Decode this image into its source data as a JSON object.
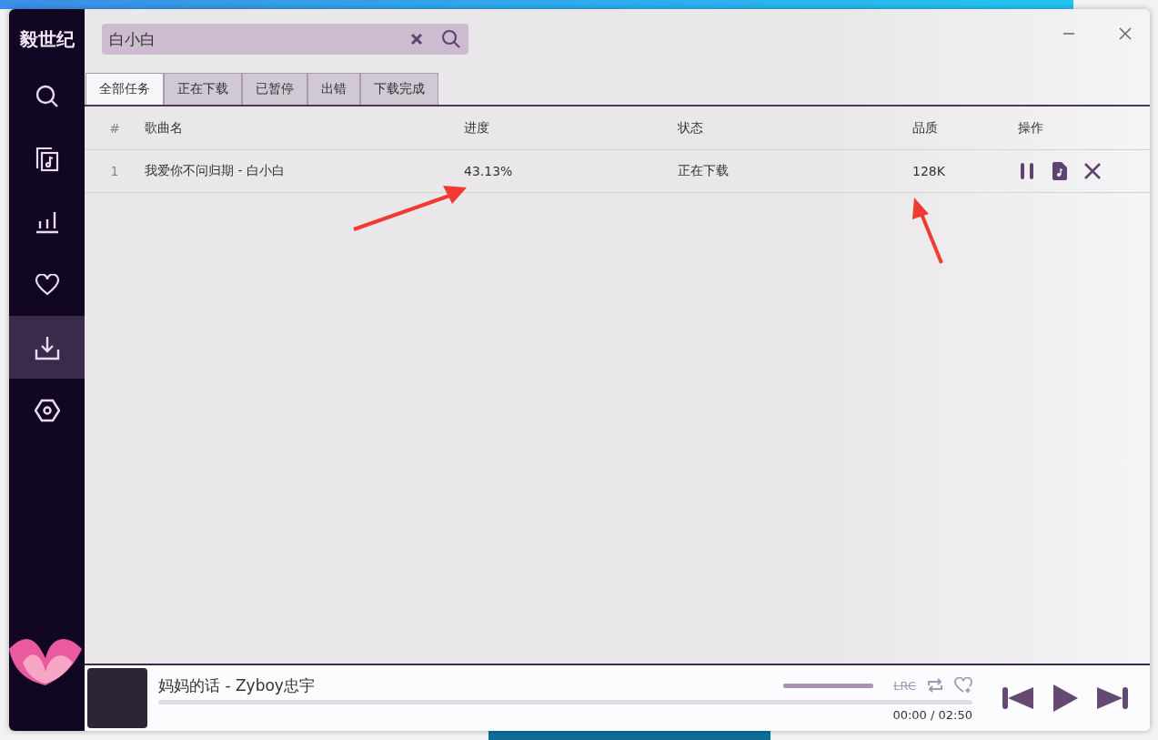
{
  "app": {
    "logo": "毅世纪"
  },
  "sidebar": {
    "items": [
      {
        "kind": "search",
        "selected": false
      },
      {
        "kind": "music",
        "selected": false
      },
      {
        "kind": "chart",
        "selected": false
      },
      {
        "kind": "heart",
        "selected": false
      },
      {
        "kind": "download",
        "selected": true
      },
      {
        "kind": "settings",
        "selected": false
      }
    ]
  },
  "search": {
    "value": "白小白"
  },
  "tabs": [
    {
      "label": "全部任务",
      "selected": true
    },
    {
      "label": "正在下载",
      "selected": false
    },
    {
      "label": "已暂停",
      "selected": false
    },
    {
      "label": "出错",
      "selected": false
    },
    {
      "label": "下载完成",
      "selected": false
    }
  ],
  "table": {
    "columns": [
      "#",
      "歌曲名",
      "进度",
      "状态",
      "品质",
      "操作"
    ],
    "rows": [
      {
        "index": "1",
        "name": "我爱你不问归期 - 白小白",
        "progress": "43.13%",
        "status": "正在下载",
        "quality": "128K"
      }
    ]
  },
  "player": {
    "title": "妈妈的话 - Zyboy忠宇",
    "volume": {
      "level": 1
    },
    "progress": {
      "level": 0
    },
    "lrc": "LRC",
    "time": "00:00 / 02:50"
  }
}
